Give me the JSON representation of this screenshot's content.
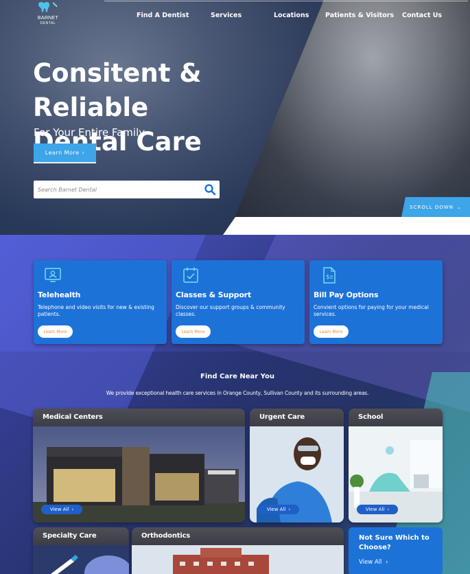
{
  "brand": {
    "logo_line1": "BARNET",
    "logo_line2": "DENTAL",
    "accent": "#3da5e8",
    "card_blue": "#1d72d8",
    "button_orange": "#e88a1a"
  },
  "nav": {
    "items": [
      "Find A Dentist",
      "Services",
      "Locations",
      "Patients & Visitors",
      "Contact Us"
    ]
  },
  "hero": {
    "title_line1": "Consitent & Reliable",
    "title_line2": "Dental Care",
    "subtitle": "For Your Entire Family",
    "cta_label": "Learn More",
    "cta_icon": "chevron-right-icon",
    "search_placeholder": "Search Barnet Dental",
    "search_icon": "search-icon",
    "scroll_label": "SCROLL DOWN",
    "scroll_icon": "chevron-down-icon"
  },
  "services": [
    {
      "icon": "telehealth-monitor-icon",
      "title": "Telehealth",
      "description": "Telephone and video visits for new & existing patients.",
      "button": "Learn More"
    },
    {
      "icon": "calendar-check-icon",
      "title": "Classes & Support",
      "description": "Discover our support groups & community classes.",
      "button": "Learn More"
    },
    {
      "icon": "invoice-dollar-icon",
      "title": "Bill Pay Options",
      "description": "Convient options for paying for your medical services.",
      "button": "Learn More"
    }
  ],
  "find_care": {
    "title": "Find Care Near You",
    "description": "We provide exceptional health care services in Orange County, Sullivan County and its surrounding areas."
  },
  "care_cards": [
    {
      "title": "Medical Centers",
      "button": "View All"
    },
    {
      "title": "Urgent Care",
      "button": "View All"
    },
    {
      "title": "School",
      "button": "View All"
    },
    {
      "title": "Specialty Care"
    },
    {
      "title": "Orthodontics"
    }
  ],
  "unsure": {
    "title": "Not Sure Which to Choose?",
    "link": "View All"
  }
}
